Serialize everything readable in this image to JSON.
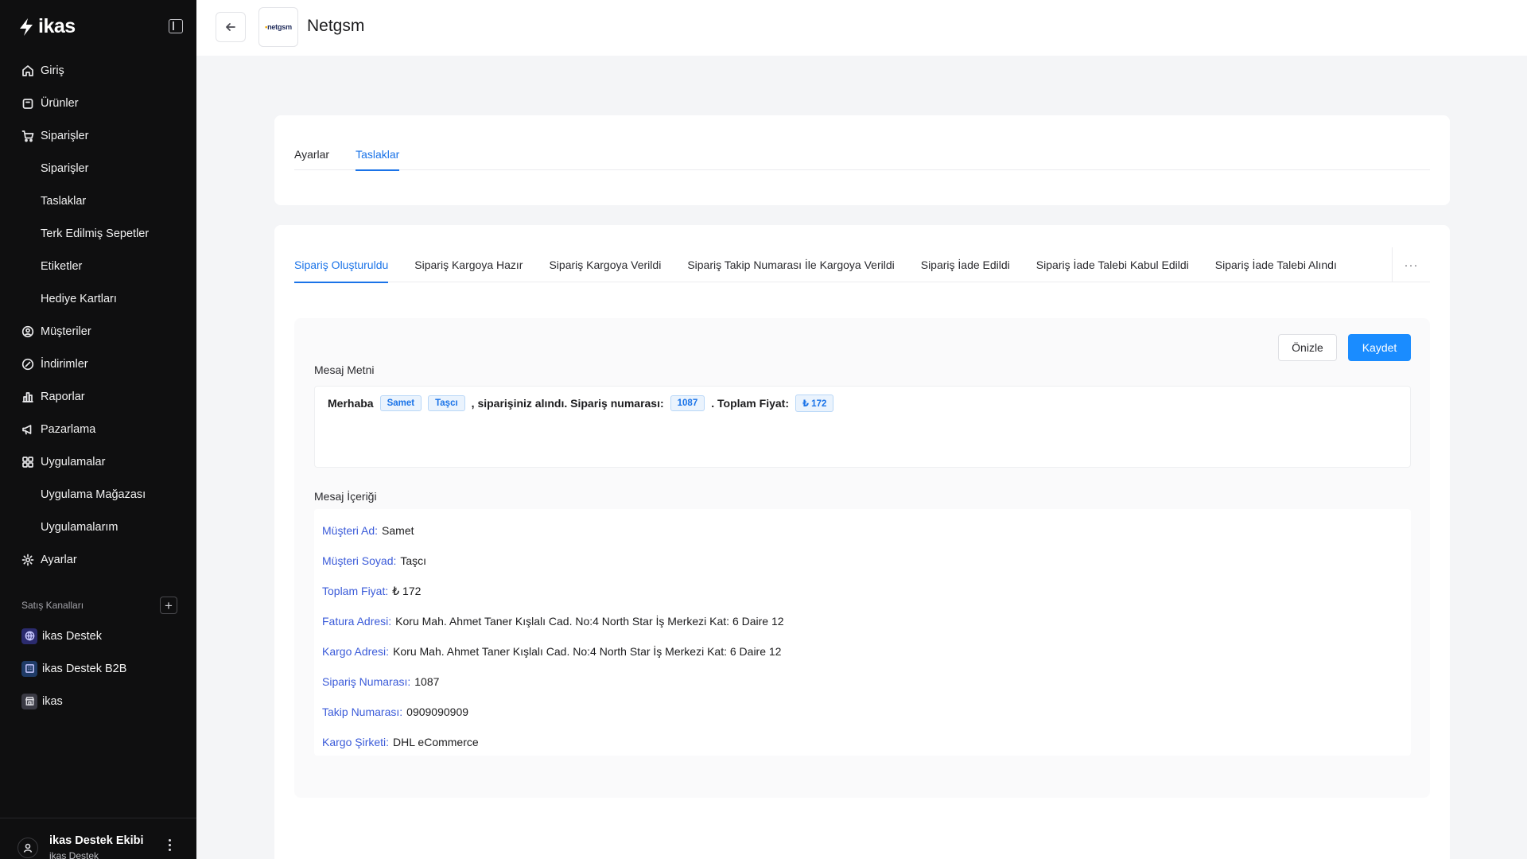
{
  "brand": {
    "name": "ikas"
  },
  "sidebar": {
    "items": [
      {
        "label": "Giriş",
        "icon": "home-icon",
        "sub": false
      },
      {
        "label": "Ürünler",
        "icon": "box-icon",
        "sub": false
      },
      {
        "label": "Siparişler",
        "icon": "cart-icon",
        "sub": false
      },
      {
        "label": "Siparişler",
        "icon": "",
        "sub": true
      },
      {
        "label": "Taslaklar",
        "icon": "",
        "sub": true
      },
      {
        "label": "Terk Edilmiş Sepetler",
        "icon": "",
        "sub": true
      },
      {
        "label": "Etiketler",
        "icon": "",
        "sub": true
      },
      {
        "label": "Hediye Kartları",
        "icon": "",
        "sub": true
      },
      {
        "label": "Müşteriler",
        "icon": "user-circle-icon",
        "sub": false
      },
      {
        "label": "İndirimler",
        "icon": "discount-icon",
        "sub": false
      },
      {
        "label": "Raporlar",
        "icon": "chart-icon",
        "sub": false
      },
      {
        "label": "Pazarlama",
        "icon": "megaphone-icon",
        "sub": false
      },
      {
        "label": "Uygulamalar",
        "icon": "grid-icon",
        "sub": false
      },
      {
        "label": "Uygulama Mağazası",
        "icon": "",
        "sub": true
      },
      {
        "label": "Uygulamalarım",
        "icon": "",
        "sub": true
      },
      {
        "label": "Ayarlar",
        "icon": "gear-icon",
        "sub": false
      }
    ],
    "channels_title": "Satış Kanalları",
    "channels": [
      {
        "label": "ikas Destek",
        "icon": "globe-icon"
      },
      {
        "label": "ikas Destek B2B",
        "icon": "building-icon"
      },
      {
        "label": "ikas",
        "icon": "store-icon"
      }
    ],
    "user": {
      "name": "ikas Destek Ekibi",
      "org": "ikas Destek"
    }
  },
  "header": {
    "title": "Netgsm",
    "app_logo_text": "netgsm"
  },
  "top_tabs": [
    {
      "label": "Ayarlar",
      "active": false
    },
    {
      "label": "Taslaklar",
      "active": true
    }
  ],
  "template_tabs": [
    {
      "label": "Sipariş Oluşturuldu",
      "active": true
    },
    {
      "label": "Sipariş Kargoya Hazır",
      "active": false
    },
    {
      "label": "Sipariş Kargoya Verildi",
      "active": false
    },
    {
      "label": "Sipariş Takip Numarası İle Kargoya Verildi",
      "active": false
    },
    {
      "label": "Sipariş İade Edildi",
      "active": false
    },
    {
      "label": "Sipariş İade Talebi Kabul Edildi",
      "active": false
    },
    {
      "label": "Sipariş İade Talebi Alındı",
      "active": false
    }
  ],
  "more_label": "···",
  "actions": {
    "preview": "Önizle",
    "save": "Kaydet"
  },
  "message": {
    "label": "Mesaj Metni",
    "parts": {
      "greeting": "Merhaba",
      "first_name": "Samet",
      "last_name": "Taşcı",
      "text1": ", siparişiniz alındı. Sipariş numarası:",
      "order_no": "1087",
      "text2": ". Toplam Fiyat:",
      "total": "₺ 172"
    }
  },
  "content": {
    "label": "Mesaj İçeriği",
    "rows": [
      {
        "key": "Müşteri Ad:",
        "value": "Samet"
      },
      {
        "key": "Müşteri Soyad:",
        "value": "Taşcı"
      },
      {
        "key": "Toplam Fiyat:",
        "value": "₺ 172"
      },
      {
        "key": "Fatura Adresi:",
        "value": "Koru Mah. Ahmet Taner Kışlalı Cad. No:4 North Star İş Merkezi Kat: 6 Daire 12"
      },
      {
        "key": "Kargo Adresi:",
        "value": "Koru Mah. Ahmet Taner Kışlalı Cad. No:4 North Star İş Merkezi Kat: 6 Daire 12"
      },
      {
        "key": "Sipariş Numarası:",
        "value": "1087"
      },
      {
        "key": "Takip Numarası:",
        "value": "0909090909"
      },
      {
        "key": "Kargo Şirketi:",
        "value": "DHL eCommerce"
      }
    ]
  },
  "colors": {
    "accent": "#1a73e8",
    "button": "#1a8cff",
    "sidebar": "#0f0f10",
    "key_text": "#3b5bd9"
  }
}
